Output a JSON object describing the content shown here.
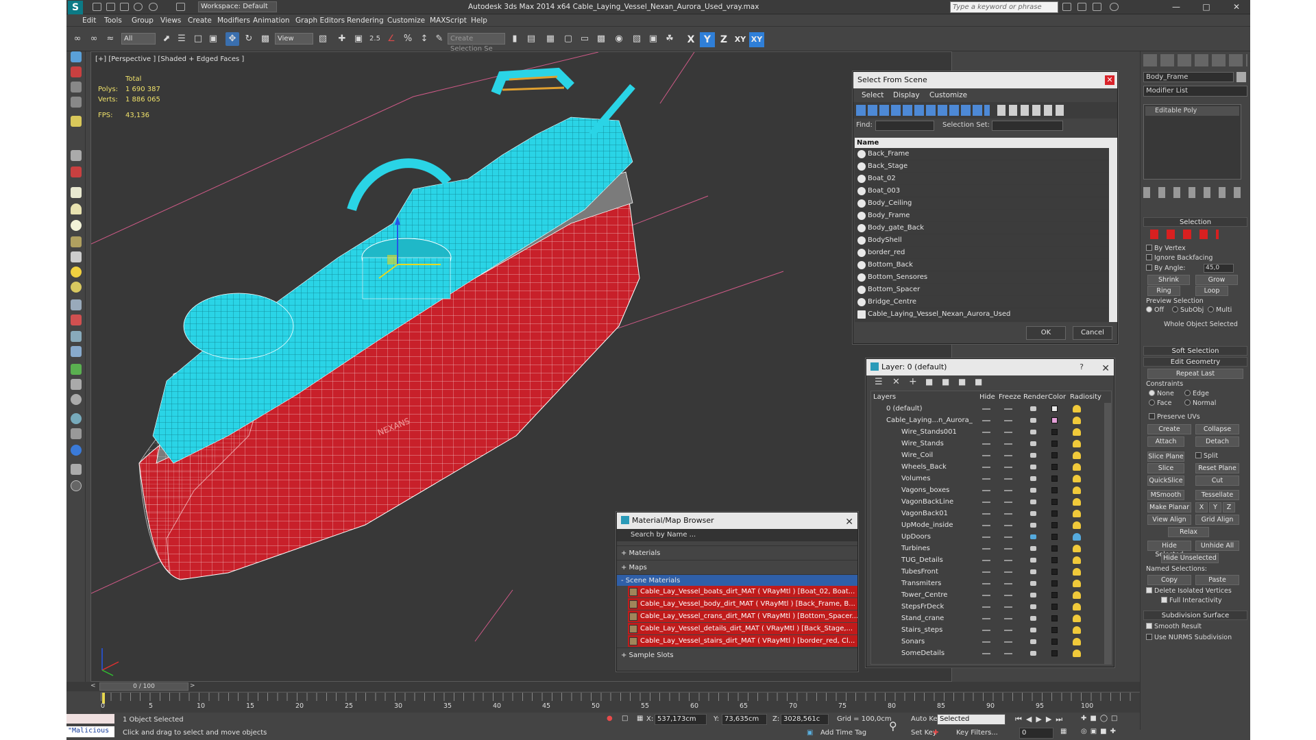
{
  "titlebar": {
    "workspace": "Workspace: Default",
    "title": "Autodesk 3ds Max  2014 x64      Cable_Laying_Vessel_Nexan_Aurora_Used_vray.max",
    "search_placeholder": "Type a keyword or phrase"
  },
  "menu": [
    "Edit",
    "Tools",
    "Group",
    "Views",
    "Create",
    "Modifiers",
    "Animation",
    "Graph Editors",
    "Rendering",
    "Customize",
    "MAXScript",
    "Help"
  ],
  "toolbar": {
    "filter_value": "All",
    "ref_coord_value": "View",
    "selection_set_placeholder": "Create Selection Se",
    "angle_snap": "2.5",
    "axes": [
      "X",
      "Y",
      "Z",
      "XY",
      "XY"
    ]
  },
  "viewport": {
    "label": "[+] [Perspective ] [Shaded + Edged Faces ]",
    "stats_total": "Total",
    "polys_label": "Polys:",
    "polys_value": "1 690 387",
    "verts_label": "Verts:",
    "verts_value": "1 886 065",
    "fps_label": "FPS:",
    "fps_value": "43,136"
  },
  "select_from_scene": {
    "title": "Select From Scene",
    "tabs": [
      "Select",
      "Display",
      "Customize"
    ],
    "find_label": "Find:",
    "selection_set_label": "Selection Set:",
    "column": "Name",
    "items": [
      "Back_Frame",
      "Back_Stage",
      "Boat_02",
      "Boat_003",
      "Body_Ceiling",
      "Body_Frame",
      "Body_gate_Back",
      "BodyShell",
      "border_red",
      "Bottom_Back",
      "Bottom_Sensores",
      "Bottom_Spacer",
      "Bridge_Centre",
      "Cable_Laying_Vessel_Nexan_Aurora_Used"
    ],
    "ok": "OK",
    "cancel": "Cancel"
  },
  "layer_dialog": {
    "title": "Layer: 0 (default)",
    "help": "?",
    "columns": [
      "Layers",
      "Hide",
      "Freeze",
      "Render",
      "Color",
      "Radiosity"
    ],
    "rows": [
      "0 (default)",
      "Cable_Laying...n_Aurora_",
      "Wire_Stands001",
      "Wire_Stands",
      "Wire_Coil",
      "Wheels_Back",
      "Volumes",
      "Vagons_boxes",
      "VagonBackLine",
      "VagonBack01",
      "UpMode_inside",
      "UpDoors",
      "Turbines",
      "TUG_Details",
      "TubesFront",
      "Transmiters",
      "Tower_Centre",
      "StepsFrDeck",
      "Stand_crane",
      "Stairs_steps",
      "Sonars",
      "SomeDetails"
    ]
  },
  "material_browser": {
    "title": "Material/Map Browser",
    "search_placeholder": "Search by Name ...",
    "groups": [
      "+ Materials",
      "+ Maps",
      "- Scene Materials"
    ],
    "scene_materials": [
      "Cable_Lay_Vessel_boats_dirt_MAT ( VRayMtl ) [Boat_02, Boat...",
      "Cable_Lay_Vessel_body_dirt_MAT ( VRayMtl ) [Back_Frame, B...",
      "Cable_Lay_Vessel_crans_dirt_MAT ( VRayMtl ) [Bottom_Spacer...",
      "Cable_Lay_Vessel_details_dirt_MAT ( VRayMtl ) [Back_Stage,...",
      "Cable_Lay_Vessel_stairs_dirt_MAT ( VRayMtl ) [border_red, Cl..."
    ],
    "sample_slots": "+ Sample Slots"
  },
  "command_panel": {
    "object_name": "Body_Frame",
    "modifier_list": "Modifier List",
    "stack_item": "Editable Poly",
    "selection_title": "Selection",
    "by_vertex": "By Vertex",
    "ignore_backfacing": "Ignore Backfacing",
    "by_angle": "By Angle:",
    "by_angle_value": "45,0",
    "shrink": "Shrink",
    "grow": "Grow",
    "ring": "Ring",
    "loop": "Loop",
    "preview_selection": "Preview Selection",
    "preview_off": "Off",
    "preview_subobj": "SubObj",
    "preview_multi": "Multi",
    "whole_object": "Whole Object Selected",
    "soft_selection": "Soft Selection",
    "edit_geometry": "Edit Geometry",
    "repeat_last": "Repeat Last",
    "constraints": "Constraints",
    "c_none": "None",
    "c_edge": "Edge",
    "c_face": "Face",
    "c_normal": "Normal",
    "preserve_uvs": "Preserve UVs",
    "create": "Create",
    "collapse": "Collapse",
    "attach": "Attach",
    "detach": "Detach",
    "slice_plane": "Slice Plane",
    "split": "Split",
    "slice": "Slice",
    "reset_plane": "Reset Plane",
    "quickslice": "QuickSlice",
    "cut": "Cut",
    "msmooth": "MSmooth",
    "tessellate": "Tessellate",
    "make_planar": "Make Planar",
    "x": "X",
    "y": "Y",
    "z": "Z",
    "view_align": "View Align",
    "grid_align": "Grid Align",
    "relax": "Relax",
    "hide_selected": "Hide Selected",
    "unhide_all": "Unhide All",
    "hide_unselected": "Hide Unselected",
    "named_selections": "Named Selections:",
    "copy": "Copy",
    "paste": "Paste",
    "delete_isolated": "Delete Isolated Vertices",
    "full_interactivity": "Full Interactivity",
    "subdivision_surface": "Subdivision Surface",
    "smooth_result": "Smooth Result",
    "use_nurms": "Use NURMS Subdivision"
  },
  "timeline": {
    "frame_counter": "0 / 100",
    "ticks": [
      "0",
      "5",
      "10",
      "15",
      "20",
      "25",
      "30",
      "35",
      "40",
      "45",
      "50",
      "55",
      "60",
      "65",
      "70",
      "75",
      "80",
      "85",
      "90",
      "95",
      "100"
    ]
  },
  "status": {
    "maxscript": "\"Malicious s",
    "selected": "1 Object Selected",
    "prompt": "Click and drag to select and move objects",
    "x_label": "X:",
    "x_value": "537,173cm",
    "y_label": "Y:",
    "y_value": "73,635cm",
    "z_label": "Z:",
    "z_value": "3028,561c",
    "grid": "Grid = 100,0cm",
    "add_time_tag": "Add Time Tag",
    "auto_key": "Auto Key",
    "set_key": "Set Key",
    "key_mode": "Selected",
    "key_filters": "Key Filters...",
    "frame": "0"
  },
  "colors": {
    "wire_cyan": "#2fd6e6",
    "hull_red": "#c8202a",
    "orange_accent": "#e0a030"
  }
}
